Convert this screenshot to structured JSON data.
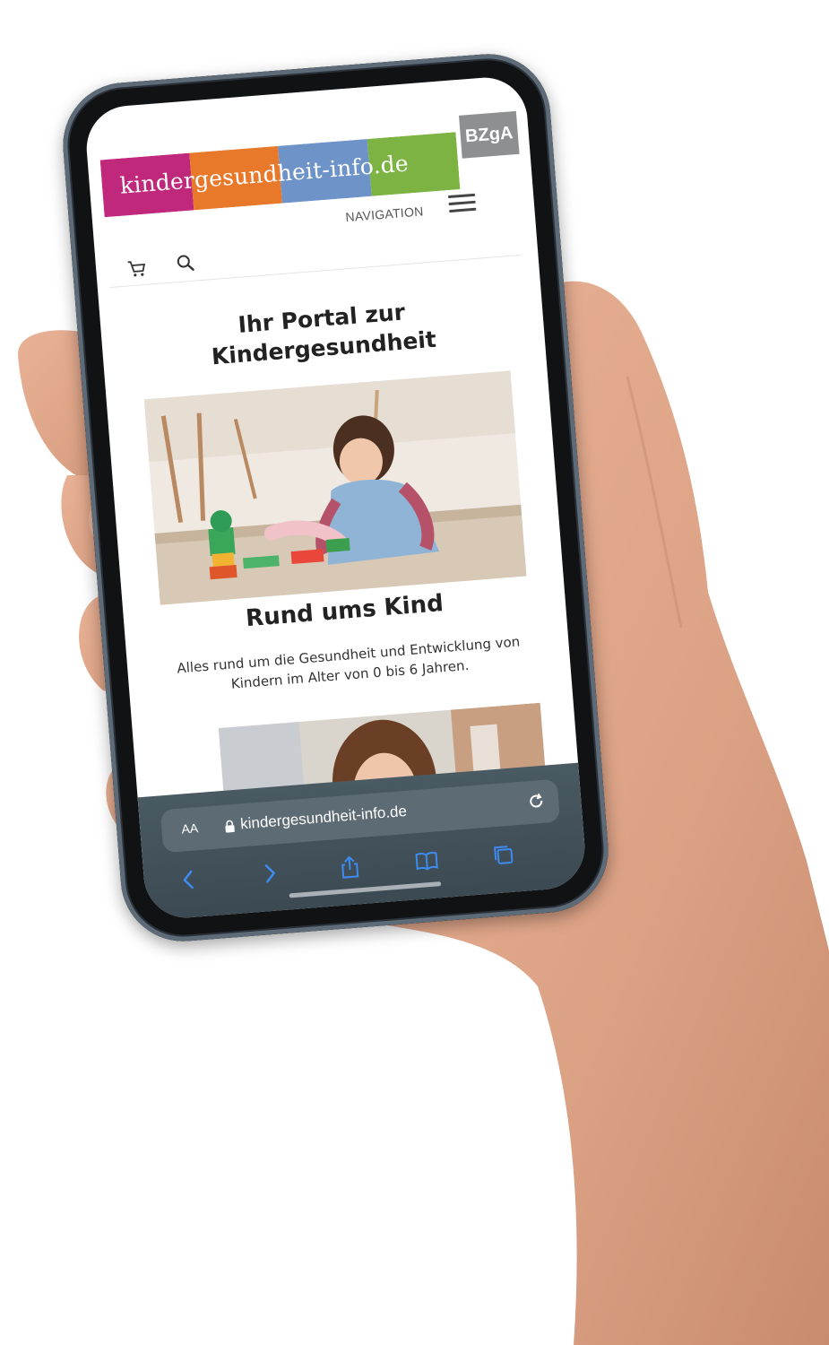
{
  "site": {
    "logo_text": "kindergesundheit-info.de",
    "logo_colors": [
      "#c0297b",
      "#e8792a",
      "#6d93c8",
      "#7cb342"
    ],
    "partner_logo": "BZgA",
    "partner_color": "#8e8f90",
    "nav_label": "NAVIGATION",
    "cart_icon": "cart-icon",
    "search_icon": "search-icon",
    "menu_icon": "hamburger-icon"
  },
  "content": {
    "page_title_line1": "Ihr Portal zur",
    "page_title_line2": "Kindergesundheit",
    "section_title": "Rund ums Kind",
    "section_desc": "Alles rund um die Gesundheit und Entwicklung von Kindern im Alter von 0 bis 6 Jahren."
  },
  "browser": {
    "text_size_label": "AA",
    "url": "kindergesundheit-info.de",
    "toolbar_icons": [
      "back-icon",
      "forward-icon",
      "share-icon",
      "bookmarks-icon",
      "tabs-icon"
    ],
    "accent": "#3d8bf0"
  }
}
